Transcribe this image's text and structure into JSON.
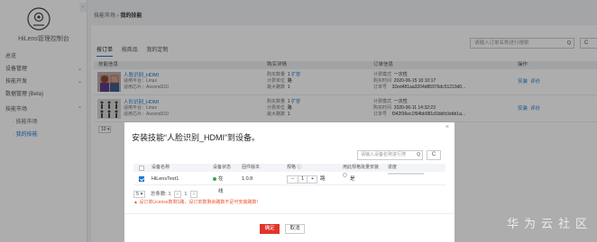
{
  "sidebar": {
    "title": "HiLens管理控制台",
    "collapse_glyph": "‹",
    "items": [
      {
        "label": "总览",
        "chev": ""
      },
      {
        "label": "设备管理",
        "chev": "⌄"
      },
      {
        "label": "技能开发",
        "chev": "⌄"
      },
      {
        "label": "数据管理 (Beta)",
        "chev": ""
      },
      {
        "label": "技能市场",
        "chev": "⌃"
      },
      {
        "label": "· 技能市场",
        "chev": ""
      },
      {
        "label": "· 我的技能",
        "chev": ""
      }
    ]
  },
  "breadcrumb": {
    "parent": "技能市场",
    "sep": " › ",
    "current": "我的技能"
  },
  "tabs": [
    "按订单",
    "按商品",
    "我的定制"
  ],
  "search": {
    "placeholder": "请输入订单名称进行搜索",
    "icon": "Q"
  },
  "cut_button": "C",
  "table": {
    "headers": [
      "技能信息",
      "购买详情",
      "订单信息",
      "操作"
    ],
    "rows": [
      {
        "name": "人脸识别_HDMI",
        "platform": "适用平台：Linux",
        "chip": "适用芯片：Ascend310",
        "qty_label": "购买数量",
        "qty": "1",
        "qty_link": "扩容",
        "unit_label": "计费单位",
        "unit": "路",
        "max_label": "最大路数",
        "max": "1",
        "bill_label": "计费模式",
        "bill": "一次性",
        "time_label": "购买时间",
        "time": "2020-06-15 10:10:17",
        "order_label": "订单号",
        "order": "32ed481aa3204d85976dc51219d0...",
        "op1": "安装",
        "op2": "评价"
      },
      {
        "name": "人形识别_HDMI",
        "platform": "适用平台：Linux",
        "chip": "适用芯片：Ascend310",
        "qty_label": "购买数量",
        "qty": "1",
        "qty_link": "扩容",
        "unit_label": "计费单位",
        "unit": "路",
        "max_label": "最大路数",
        "max": "1",
        "bill_label": "计费模式",
        "bill": "一次性",
        "time_label": "购买时间",
        "time": "2020-06-11 14:32:23",
        "order_label": "订单号",
        "order": "f342f36ec1f94bb981d1bbfc0ebb1a...",
        "op1": "安装",
        "op2": "评价"
      }
    ]
  },
  "pager_mini": "10 ▾",
  "dialog": {
    "title": "安装技能“人脸识别_HDMI”到设备。",
    "close": "×",
    "search_placeholder": "请输入设备名称进行搜",
    "search_icon": "Q",
    "refresh": "C",
    "headers": [
      "设备名称",
      "设备状态",
      "固件版本",
      "规格 ⓘ",
      "用此规格批量安装",
      "进度"
    ],
    "device": {
      "name": "HiLensTest1",
      "status": "在线",
      "firmware": "1.0.8",
      "spec_minus": "−",
      "spec_value": "1",
      "spec_plus": "+",
      "spec_unit": "路",
      "batch": "是"
    },
    "pager": {
      "size": "5 ▾",
      "total": "总条数: 1",
      "prev": "‹",
      "page": "1",
      "next": "›"
    },
    "warning": "▲ 设订单License数剩1路，设订单数剩余路数不足可安装路数！",
    "ok": "确定",
    "cancel": "取消"
  },
  "watermark": "华为云社区",
  "colors": {
    "accent": "#1a76d2",
    "danger": "#e1352c",
    "online": "#3aa655",
    "warning": "#e8532d"
  }
}
